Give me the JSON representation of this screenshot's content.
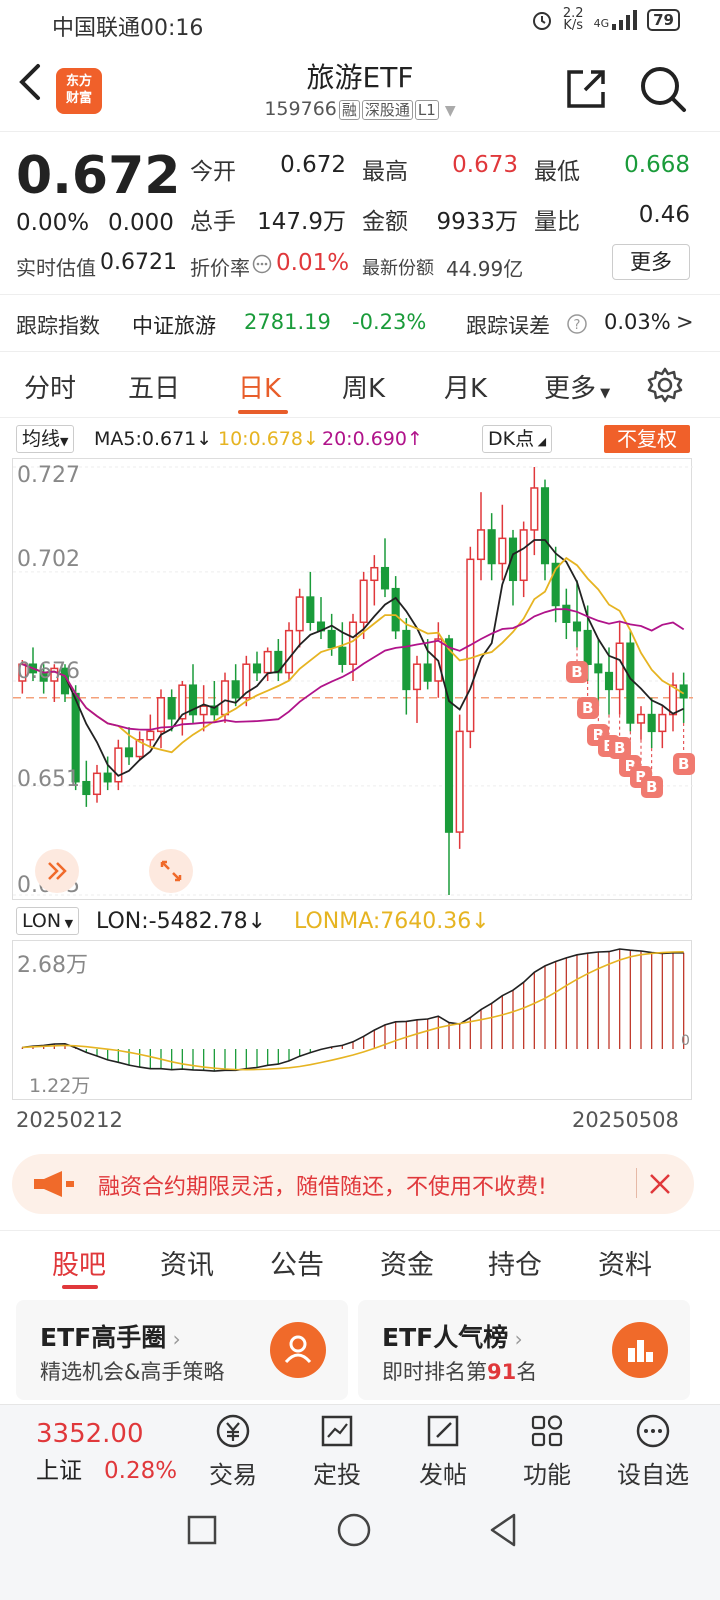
{
  "status": {
    "carrier_time": "中国联通00:16",
    "net_speed_val": "2.2",
    "net_speed_unit": "K/s",
    "signal": "4G",
    "battery": "79"
  },
  "header": {
    "title": "旅游ETF",
    "code": "159766",
    "tag_rong": "融",
    "tag_sgt": "深股通",
    "tag_l1": "L1",
    "logo_line1": "东方",
    "logo_line2": "财富"
  },
  "quote": {
    "price": "0.672",
    "change_pct": "0.00%",
    "change_amt": "0.000",
    "open_label": "今开",
    "open": "0.672",
    "high_label": "最高",
    "high": "0.673",
    "low_label": "最低",
    "low": "0.668",
    "vol_label": "总手",
    "vol": "147.9万",
    "amt_label": "金额",
    "amt": "9933万",
    "ratio_label": "量比",
    "ratio": "0.46",
    "est_label": "实时估值",
    "est": "0.6721",
    "premium_label": "折价率",
    "premium": "0.01%",
    "shares_label": "最新份额",
    "shares": "44.99亿",
    "more": "更多"
  },
  "tracking": {
    "label": "跟踪指数",
    "index": "中证旅游",
    "value": "2781.19",
    "pct": "-0.23%",
    "err_label": "跟踪误差",
    "err": "0.03%",
    "arrow": ">"
  },
  "chart_tabs": [
    "分时",
    "五日",
    "日K",
    "周K",
    "月K",
    "更多"
  ],
  "ma": {
    "selector": "均线",
    "ma5": "MA5:0.671↓",
    "ma10": "10:0.678↓",
    "ma20": "20:0.690↑",
    "dk": "DK点",
    "fq": "不复权"
  },
  "colors": {
    "up": "#e0383b",
    "down": "#1a9b3a",
    "accent": "#f0602a",
    "ma5": "#222222",
    "ma10": "#e6b422",
    "ma20": "#b0138a"
  },
  "chart_data": {
    "type": "candlestick",
    "y_ticks": [
      "0.727",
      "0.702",
      "0.676",
      "0.651",
      "0.625"
    ],
    "ylim": [
      0.625,
      0.727
    ],
    "x_start": "20250212",
    "x_end": "20250508",
    "b_signal_label": "B",
    "candles": [
      [
        0.676,
        0.681,
        0.673,
        0.68
      ],
      [
        0.68,
        0.684,
        0.676,
        0.678
      ],
      [
        0.678,
        0.68,
        0.673,
        0.676
      ],
      [
        0.676,
        0.68,
        0.671,
        0.679
      ],
      [
        0.679,
        0.68,
        0.671,
        0.673
      ],
      [
        0.673,
        0.675,
        0.65,
        0.652
      ],
      [
        0.652,
        0.657,
        0.646,
        0.649
      ],
      [
        0.649,
        0.656,
        0.647,
        0.654
      ],
      [
        0.654,
        0.658,
        0.65,
        0.652
      ],
      [
        0.652,
        0.662,
        0.65,
        0.66
      ],
      [
        0.66,
        0.665,
        0.656,
        0.658
      ],
      [
        0.658,
        0.664,
        0.657,
        0.662
      ],
      [
        0.662,
        0.668,
        0.66,
        0.664
      ],
      [
        0.664,
        0.674,
        0.66,
        0.672
      ],
      [
        0.672,
        0.674,
        0.664,
        0.667
      ],
      [
        0.667,
        0.676,
        0.663,
        0.675
      ],
      [
        0.675,
        0.68,
        0.666,
        0.668
      ],
      [
        0.668,
        0.675,
        0.664,
        0.67
      ],
      [
        0.67,
        0.676,
        0.666,
        0.668
      ],
      [
        0.668,
        0.678,
        0.666,
        0.676
      ],
      [
        0.676,
        0.68,
        0.67,
        0.672
      ],
      [
        0.672,
        0.682,
        0.67,
        0.68
      ],
      [
        0.68,
        0.683,
        0.676,
        0.678
      ],
      [
        0.678,
        0.684,
        0.676,
        0.683
      ],
      [
        0.683,
        0.686,
        0.676,
        0.678
      ],
      [
        0.678,
        0.69,
        0.676,
        0.688
      ],
      [
        0.688,
        0.698,
        0.684,
        0.696
      ],
      [
        0.696,
        0.702,
        0.688,
        0.69
      ],
      [
        0.69,
        0.696,
        0.686,
        0.688
      ],
      [
        0.688,
        0.692,
        0.682,
        0.684
      ],
      [
        0.684,
        0.69,
        0.678,
        0.68
      ],
      [
        0.68,
        0.692,
        0.676,
        0.69
      ],
      [
        0.69,
        0.702,
        0.686,
        0.7
      ],
      [
        0.7,
        0.706,
        0.694,
        0.703
      ],
      [
        0.703,
        0.71,
        0.696,
        0.698
      ],
      [
        0.698,
        0.701,
        0.686,
        0.688
      ],
      [
        0.688,
        0.691,
        0.668,
        0.674
      ],
      [
        0.674,
        0.682,
        0.666,
        0.68
      ],
      [
        0.68,
        0.686,
        0.674,
        0.676
      ],
      [
        0.676,
        0.69,
        0.672,
        0.686
      ],
      [
        0.686,
        0.687,
        0.625,
        0.64
      ],
      [
        0.64,
        0.668,
        0.636,
        0.664
      ],
      [
        0.664,
        0.708,
        0.66,
        0.705
      ],
      [
        0.705,
        0.721,
        0.7,
        0.712
      ],
      [
        0.712,
        0.716,
        0.7,
        0.704
      ],
      [
        0.704,
        0.718,
        0.7,
        0.71
      ],
      [
        0.71,
        0.712,
        0.694,
        0.7
      ],
      [
        0.7,
        0.714,
        0.696,
        0.712
      ],
      [
        0.712,
        0.727,
        0.706,
        0.722
      ],
      [
        0.722,
        0.724,
        0.7,
        0.704
      ],
      [
        0.704,
        0.708,
        0.69,
        0.694
      ],
      [
        0.694,
        0.698,
        0.686,
        0.69
      ],
      [
        0.69,
        0.7,
        0.684,
        0.688
      ],
      [
        0.688,
        0.694,
        0.676,
        0.68
      ],
      [
        0.68,
        0.686,
        0.67,
        0.678
      ],
      [
        0.678,
        0.684,
        0.668,
        0.674
      ],
      [
        0.674,
        0.69,
        0.668,
        0.685
      ],
      [
        0.685,
        0.688,
        0.664,
        0.666
      ],
      [
        0.666,
        0.67,
        0.662,
        0.668
      ],
      [
        0.668,
        0.672,
        0.66,
        0.664
      ],
      [
        0.664,
        0.67,
        0.66,
        0.668
      ],
      [
        0.668,
        0.678,
        0.664,
        0.675
      ],
      [
        0.675,
        0.678,
        0.666,
        0.672
      ]
    ],
    "b_signals": [
      52,
      53,
      54,
      55,
      56,
      57,
      58,
      59,
      62
    ]
  },
  "lon": {
    "selector": "LON",
    "lon": "LON:-5482.78↓",
    "lonma": "LONMA:7640.36↓",
    "y_top": "2.68万",
    "y_bottom": "1.22万",
    "zero": "0"
  },
  "banner": {
    "text": "融资合约期限灵活，随借随还，不使用不收费!"
  },
  "info_tabs": [
    "股吧",
    "资讯",
    "公告",
    "资金",
    "持仓",
    "资料"
  ],
  "cards": [
    {
      "title": "ETF高手圈",
      "sub": "精选机会&高手策略"
    },
    {
      "title": "ETF人气榜",
      "sub_pre": "即时排名第",
      "rank": "91",
      "sub_post": "名"
    }
  ],
  "toolbar": {
    "index_value": "3352.00",
    "index_name": "上证",
    "index_pct": "0.28%",
    "trade": "交易",
    "invest": "定投",
    "post": "发帖",
    "function": "功能",
    "watch": "设自选"
  }
}
